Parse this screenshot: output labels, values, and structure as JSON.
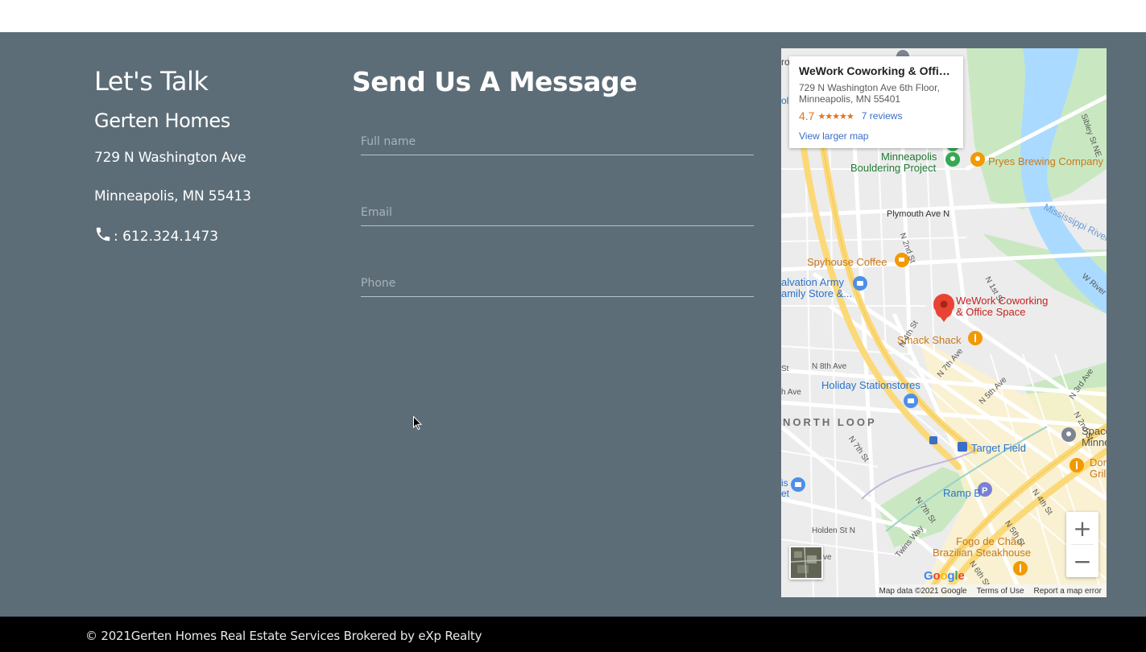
{
  "contact": {
    "heading": "Let's Talk",
    "company": "Gerten Homes",
    "address_line1": "729 N Washington Ave",
    "address_line2": "Minneapolis, MN 55413",
    "phone_label": ": 612.324.1473",
    "phone_icon": "phone-icon"
  },
  "form": {
    "heading": "Send Us A Message",
    "fullname_placeholder": "Full name",
    "email_placeholder": "Email",
    "phone_placeholder": "Phone"
  },
  "map": {
    "card": {
      "title": "WeWork Coworking & Office S...",
      "address_line1": "729 N Washington Ave 6th Floor,",
      "address_line2": "Minneapolis, MN 55401",
      "rating": "4.7",
      "stars": "★★★★★",
      "reviews": "7 reviews",
      "larger_map": "View larger map"
    },
    "places": {
      "bouldering_1": "Minneapolis",
      "bouldering_2": "Bouldering Project",
      "pryes": "Pryes Brewing Company",
      "spyhouse": "Spyhouse Coffee",
      "salvation_1": "alvation Army",
      "salvation_2": "amily Store &...",
      "wework_1": "WeWork Coworking",
      "wework_2": "& Office Space",
      "smack": "Smack Shack",
      "holiday": "Holiday Stationstores",
      "north_loop": "NORTH LOOP",
      "target_field": "Target Field",
      "ramp_b": "Ramp B",
      "fogo_1": "Fogo de Chão",
      "fogo_2": "Brazilian Steakhouse",
      "space_1": "Space",
      "space_2": "Minne",
      "don_1": "Don",
      "don_2": "Grill",
      "river": "Mississippi River"
    },
    "streets": {
      "plymouth": "Plymouth Ave N",
      "n2nd": "N 2nd St",
      "n8th": "N 8th Ave",
      "n7th": "N 7th Ave",
      "n4th": "N 4th St",
      "n5th": "N 5th Ave",
      "n7thst": "N 7th St",
      "n7thst2": "N 7th St",
      "holden": "Holden St N",
      "twins": "Twins Way",
      "n4thst": "N 4th St",
      "n5thst": "N 5th St",
      "n1st": "N 1st St",
      "wriver": "W River",
      "n3rd": "N 3rd Ave",
      "n2nd_ave": "N 2nd St",
      "sibley": "Sibley St NE",
      "n6th": "N 6th St",
      "hAve": "h Ave",
      "ro": "ro",
      "oli": "oli",
      "st_left": "St",
      "ve_left": "ve",
      "is_left": "is",
      "et_left": "et"
    },
    "zoom_in": "+",
    "zoom_out": "−",
    "google": [
      "G",
      "o",
      "o",
      "g",
      "l",
      "e"
    ],
    "google_colors": [
      "#4285f4",
      "#ea4335",
      "#fbbc05",
      "#4285f4",
      "#34a853",
      "#ea4335"
    ],
    "attribution": "Map data ©2021 Google",
    "terms": "Terms of Use",
    "report": "Report a map error"
  },
  "footer": {
    "text": "© 2021Gerten Homes Real Estate Services Brokered by eXp Realty"
  },
  "colors": {
    "section_bg": "#5d6d77",
    "footer_bg": "#000000",
    "map_water": "#aadaff",
    "map_park": "#c9e8c2",
    "map_highway": "#fbd978"
  }
}
